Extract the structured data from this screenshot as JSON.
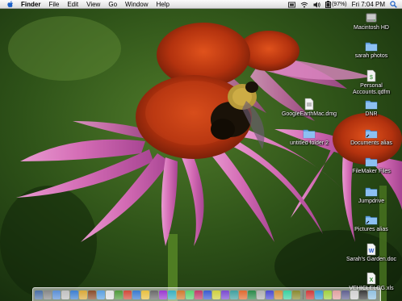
{
  "menubar": {
    "app_name": "Finder",
    "menus": [
      "File",
      "Edit",
      "View",
      "Go",
      "Window",
      "Help"
    ],
    "battery": "(97%)",
    "clock": "Fri 7:04 PM"
  },
  "desktop": {
    "icons": [
      {
        "name": "hard-drive-icon",
        "label": "Macintosh HD",
        "kind": "drive"
      },
      {
        "name": "folder-icon",
        "label": "sarah photos",
        "kind": "folder"
      },
      {
        "name": "document-icon",
        "label": "Personal Accounts.qdfm",
        "kind": "doc"
      },
      {
        "name": "folder-icon",
        "label": "DNR",
        "kind": "folder"
      },
      {
        "name": "document-icon",
        "label": "GoogleEarthMac.dmg",
        "kind": "doc"
      },
      {
        "name": "folder-icon",
        "label": "Documents alias",
        "kind": "folder"
      },
      {
        "name": "folder-icon",
        "label": "untitled folder 2",
        "kind": "folder"
      },
      {
        "name": "folder-icon",
        "label": "FileMaker Files",
        "kind": "folder"
      },
      {
        "name": "folder-icon",
        "label": "Jumpdrive",
        "kind": "folder"
      },
      {
        "name": "folder-icon",
        "label": "Pictures alias",
        "kind": "folder"
      },
      {
        "name": "document-icon",
        "label": "Sarah's Garden.doc",
        "kind": "doc"
      },
      {
        "name": "spreadsheet-icon",
        "label": "VEHICLELOG.xls",
        "kind": "xls"
      }
    ]
  },
  "dock": {
    "colors": [
      "#4a6fa5",
      "#888888",
      "#5b8fd6",
      "#c0c0c0",
      "#3d7fd0",
      "#d9a93a",
      "#8a4c2a",
      "#5aa0e0",
      "#e0e0e0",
      "#4e9a3a",
      "#d24a3a",
      "#3a7ad0",
      "#e8c040",
      "#6a6a6a",
      "#9a3ad0",
      "#3ab0c0",
      "#d07a30",
      "#5ad070",
      "#c03a6a",
      "#3a5ad0",
      "#d0d040",
      "#7a4ad0",
      "#40a0a0",
      "#e06a30",
      "#2a8a4a",
      "#b0b0b0",
      "#4a4ad0",
      "#d0903a",
      "#3ad0a0",
      "#8a8a30",
      "#d03a3a",
      "#3a9ad0",
      "#a0d040",
      "#e0a0a0",
      "#606090",
      "#d0d0d0",
      "#3a3a3a",
      "#90c0e0"
    ]
  }
}
